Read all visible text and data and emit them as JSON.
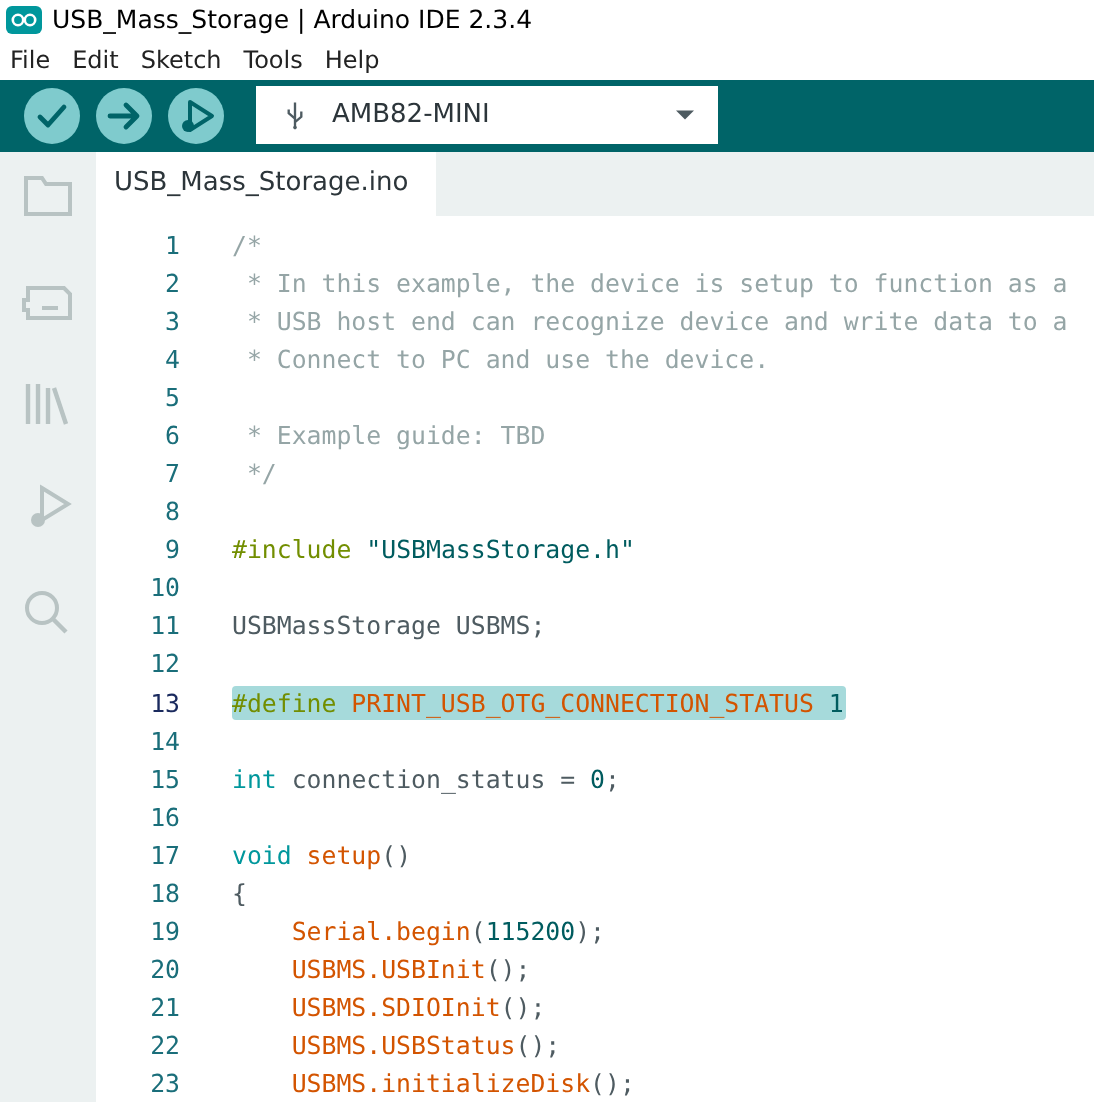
{
  "window": {
    "title": "USB_Mass_Storage | Arduino IDE 2.3.4"
  },
  "menu": [
    "File",
    "Edit",
    "Sketch",
    "Tools",
    "Help"
  ],
  "board": {
    "name": "AMB82-MINI"
  },
  "tabs": [
    {
      "label": "USB_Mass_Storage.ino",
      "selected": true
    }
  ],
  "code": [
    {
      "number": "1",
      "selected": false,
      "tokens": [
        {
          "kind": "comment",
          "text": "/*"
        }
      ]
    },
    {
      "number": "2",
      "selected": false,
      "tokens": [
        {
          "kind": "comment",
          "text": " * In this example, the device is setup to function as a"
        }
      ]
    },
    {
      "number": "3",
      "selected": false,
      "tokens": [
        {
          "kind": "comment",
          "text": " * USB host end can recognize device and write data to a"
        }
      ]
    },
    {
      "number": "4",
      "selected": false,
      "tokens": [
        {
          "kind": "comment",
          "text": " * Connect to PC and use the device."
        }
      ]
    },
    {
      "number": "5",
      "selected": false
    },
    {
      "number": "6",
      "selected": false,
      "tokens": [
        {
          "kind": "comment",
          "text": " * Example guide: TBD"
        }
      ]
    },
    {
      "number": "7",
      "selected": false,
      "tokens": [
        {
          "kind": "comment",
          "text": " */"
        }
      ]
    },
    {
      "number": "8",
      "selected": false
    },
    {
      "number": "9",
      "selected": false,
      "tokens": [
        {
          "kind": "preproc",
          "text": "#include"
        },
        {
          "kind": "string",
          "text": " \"USBMassStorage.h\""
        }
      ]
    },
    {
      "number": "10",
      "selected": false
    },
    {
      "number": "11",
      "selected": false,
      "tokens": [
        {
          "kind": "plain",
          "text": "USBMassStorage USBMS;"
        }
      ]
    },
    {
      "number": "12",
      "selected": false
    },
    {
      "number": "13",
      "selected": true,
      "tokens": [
        {
          "kind": "preproc",
          "text": "#define"
        },
        {
          "kind": "function",
          "text": " PRINT_USB_OTG_CONNECTION_STATUS"
        },
        {
          "kind": "number",
          "text": " 1"
        }
      ]
    },
    {
      "number": "14",
      "selected": false
    },
    {
      "number": "15",
      "selected": false,
      "tokens": [
        {
          "kind": "keyword",
          "text": "int"
        },
        {
          "kind": "plain",
          "text": " connection_status = "
        },
        {
          "kind": "number",
          "text": "0"
        },
        {
          "kind": "plain",
          "text": ";"
        }
      ]
    },
    {
      "number": "16",
      "selected": false
    },
    {
      "number": "17",
      "selected": false,
      "tokens": [
        {
          "kind": "keyword",
          "text": "void"
        },
        {
          "kind": "function",
          "text": " setup"
        },
        {
          "kind": "plain",
          "text": "()"
        }
      ]
    },
    {
      "number": "18",
      "selected": false,
      "tokens": [
        {
          "kind": "plain",
          "text": "{"
        }
      ]
    },
    {
      "number": "19",
      "selected": false,
      "tokens": [
        {
          "kind": "function",
          "text": "    Serial.begin"
        },
        {
          "kind": "plain",
          "text": "("
        },
        {
          "kind": "number",
          "text": "115200"
        },
        {
          "kind": "plain",
          "text": ");"
        }
      ]
    },
    {
      "number": "20",
      "selected": false,
      "tokens": [
        {
          "kind": "function",
          "text": "    USBMS.USBInit"
        },
        {
          "kind": "plain",
          "text": "();"
        }
      ]
    },
    {
      "number": "21",
      "selected": false,
      "tokens": [
        {
          "kind": "function",
          "text": "    USBMS.SDIOInit"
        },
        {
          "kind": "plain",
          "text": "();"
        }
      ]
    },
    {
      "number": "22",
      "selected": false,
      "tokens": [
        {
          "kind": "function",
          "text": "    USBMS.USBStatus"
        },
        {
          "kind": "plain",
          "text": "();"
        }
      ]
    },
    {
      "number": "23",
      "selected": false,
      "tokens": [
        {
          "kind": "function",
          "text": "    USBMS.initializeDisk"
        },
        {
          "kind": "plain",
          "text": "();"
        }
      ]
    }
  ]
}
